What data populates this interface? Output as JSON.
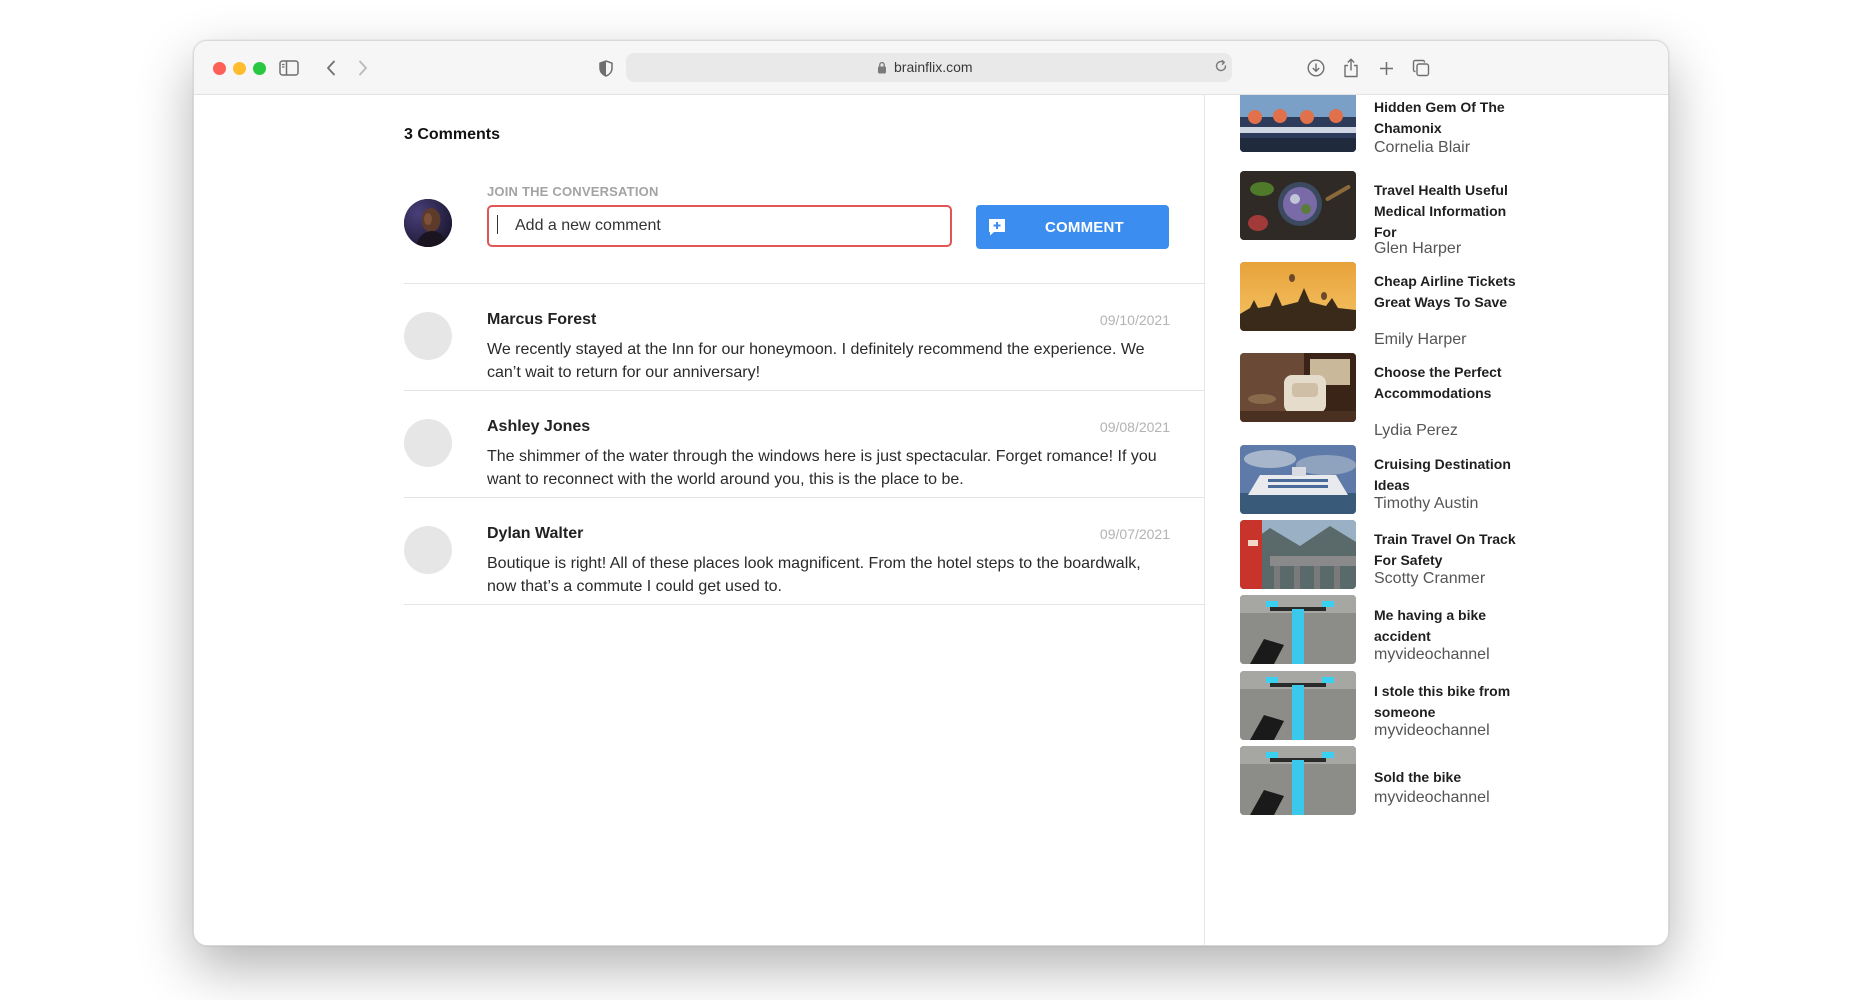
{
  "browser": {
    "url": "brainflix.com"
  },
  "comments_section": {
    "count_label": "3 Comments",
    "join_label": "JOIN THE CONVERSATION",
    "input_placeholder": "Add a new comment",
    "button_label": "COMMENT",
    "accent_color": "#3b8df0",
    "input_border_color": "#e05555",
    "comments": [
      {
        "author": "Marcus Forest",
        "date": "09/10/2021",
        "text": "We recently stayed at the Inn for our honeymoon. I definitely recommend the experience. We can’t wait to return for our anniversary!"
      },
      {
        "author": "Ashley Jones",
        "date": "09/08/2021",
        "text": "The shimmer of the water through the windows here is just spectacular. Forget romance! If you want to reconnect with the world around you, this is the place to be."
      },
      {
        "author": "Dylan Walter",
        "date": "09/07/2021",
        "text": "Boutique is right! All of these places look magnificent. From the hotel steps to the boardwalk, now that’s a commute I could get used to."
      }
    ]
  },
  "next_videos": [
    {
      "title": "Hidden Gem Of The Chamonix",
      "channel": "Cornelia Blair"
    },
    {
      "title": "Travel Health Useful Medical Information For",
      "channel": "Glen Harper"
    },
    {
      "title": "Cheap Airline Tickets Great Ways To Save",
      "channel": "Emily Harper"
    },
    {
      "title": "Choose the Perfect Accommodations",
      "channel": "Lydia Perez"
    },
    {
      "title": "Cruising Destination Ideas",
      "channel": "Timothy Austin"
    },
    {
      "title": "Train Travel On Track For Safety",
      "channel": "Scotty Cranmer"
    },
    {
      "title": "Me having a bike accident",
      "channel": "myvideochannel"
    },
    {
      "title": "I stole this bike from someone",
      "channel": "myvideochannel"
    },
    {
      "title": "Sold the bike",
      "channel": "myvideochannel"
    }
  ]
}
